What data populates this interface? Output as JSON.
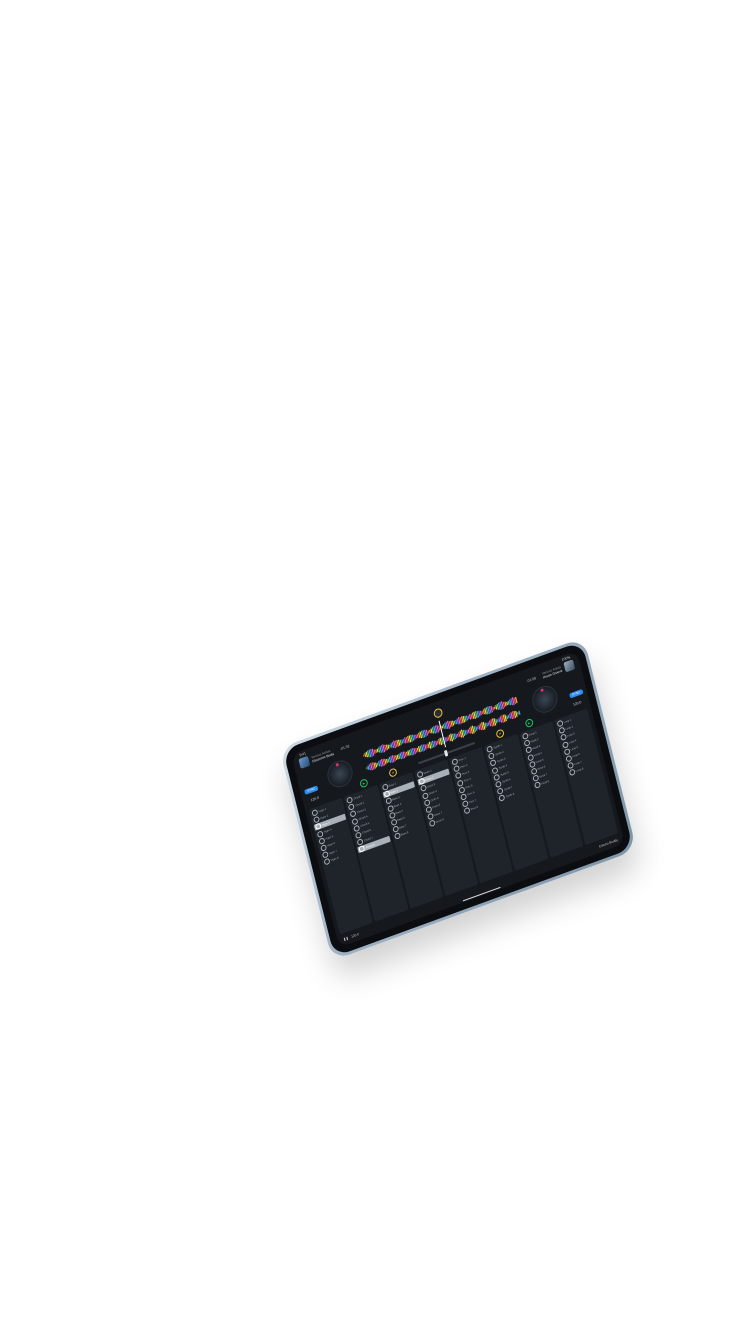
{
  "device": {
    "status": {
      "time": "9:41",
      "battery": "100%"
    }
  },
  "deck_a": {
    "artist": "Various Artists",
    "title": "Electronic Beats",
    "time": "-01:32",
    "sync_label": "SYNC",
    "bpm": "120.0"
  },
  "deck_b": {
    "artist": "Various Artists",
    "title": "House Groove",
    "time": "-01:08",
    "sync_label": "SYNC",
    "bpm": "120.0"
  },
  "controls": {
    "cue": "H",
    "fx": "FX",
    "play": "▶"
  },
  "pad_columns": [
    {
      "pads": [
        "Hype 1",
        "Hype 2",
        "Hype 3",
        "Hype 4",
        "Hype 5",
        "Hype 6",
        "Hype 7",
        "Hype 8"
      ],
      "selected": 2
    },
    {
      "pads": [
        "Chord 1",
        "Chord 2",
        "Chord 3",
        "Chord 4",
        "Chord 5",
        "Chord 6",
        "Chord 7",
        "Chord 8"
      ],
      "selected": 7
    },
    {
      "pads": [
        "Bass 1",
        "Bass 2",
        "Bass 3",
        "Bass 4",
        "Bass 5",
        "Bass 6",
        "Bass 7",
        "Bass 8"
      ],
      "selected": 1
    },
    {
      "pads": [
        "Drum 1",
        "Drum 2",
        "Drum 3",
        "Drum 4",
        "Drum 5",
        "Drum 6",
        "Drum 7",
        "Drum 8"
      ],
      "selected": 1
    },
    {
      "pads": [
        "Perc 1",
        "Perc 2",
        "Perc 3",
        "Perc 4",
        "Perc 5",
        "Perc 6",
        "Perc 7",
        "Perc 8"
      ],
      "selected": -1
    },
    {
      "pads": [
        "Synth 1",
        "Synth 2",
        "Synth 3",
        "Synth 4",
        "Synth 5",
        "Synth 6",
        "Synth 7",
        "Synth 8"
      ],
      "selected": -1
    },
    {
      "pads": [
        "Vocal 1",
        "Vocal 2",
        "Vocal 3",
        "Vocal 4",
        "Vocal 5",
        "Vocal 6",
        "Vocal 7",
        "Vocal 8"
      ],
      "selected": -1
    },
    {
      "pads": [
        "Loop 1",
        "Loop 2",
        "Loop 3",
        "Loop 4",
        "Loop 5",
        "Loop 6",
        "Loop 7",
        "Loop 8"
      ],
      "selected": -1
    }
  ],
  "bottom": {
    "tempo": "120.0",
    "pack": "Electro Buddy"
  }
}
